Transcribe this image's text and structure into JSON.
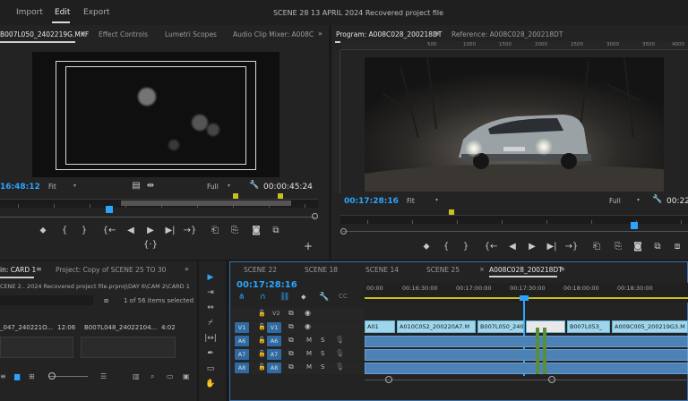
{
  "menu": {
    "import": "Import",
    "edit": "Edit",
    "export": "Export"
  },
  "window_title": "SCENE 28 13 APRIL 2024 Recovered project file",
  "source_panel": {
    "tabs": [
      "B007L050_2402219G.MXF",
      "Effect Controls",
      "Lumetri Scopes",
      "Audio Clip Mixer: A008C"
    ],
    "timecode": "16:48:12",
    "fit": "Fit",
    "quality": "Full",
    "duration": "00:00:45:24"
  },
  "program_panel": {
    "tabs": [
      "Program: A008C028_200218DT",
      "Reference: A008C028_200218DT"
    ],
    "timecode": "00:17:28:16",
    "fit": "Fit",
    "quality": "Full",
    "duration": "00:22",
    "ruler_labels": [
      "500",
      "1000",
      "1500",
      "2000",
      "2500",
      "3000",
      "3500",
      "4000"
    ]
  },
  "project_panel": {
    "tabs": [
      "in: CARD 1",
      "Project: Copy of SCENE 25 TO 30"
    ],
    "path": "CENE 2.. 2024 Recovered project file.prproj\\DAY 6\\CAM 2\\CARD 1",
    "selection": "1 of 56 items selected",
    "items": [
      {
        "name": "_047_240221O...",
        "duration": "12:06"
      },
      {
        "name": "B007L048_24022104...",
        "duration": "4:02"
      }
    ]
  },
  "timeline": {
    "tabs": [
      "SCENE 22",
      "SCENE 18",
      "SCENE 14",
      "SCENE 25",
      "A008C028_200218DT"
    ],
    "timecode": "00:17:28:16",
    "ruler_labels": [
      "00:00",
      "00:16:30:00",
      "00:17:00:00",
      "00:17:30:00",
      "00:18:00:00",
      "00:18:30:00"
    ],
    "video_tracks": [
      {
        "label": "V2",
        "src": ""
      },
      {
        "label": "V1",
        "src": "V1"
      }
    ],
    "audio_tracks": [
      {
        "label": "A6",
        "src": "A6",
        "m": "M",
        "s": "S"
      },
      {
        "label": "A7",
        "src": "A7",
        "m": "M",
        "s": "S"
      },
      {
        "label": "A8",
        "src": "A8",
        "m": "M",
        "s": "S"
      }
    ],
    "clips": [
      {
        "name": "A01"
      },
      {
        "name": "A010C052_200220A7.M"
      },
      {
        "name": "B007L050_240"
      },
      {
        "name": "B007L053_"
      },
      {
        "name": "A009C005_200219G3.M"
      }
    ]
  },
  "colors": {
    "accent": "#2aa5ff",
    "video_clip": "#9fd6ee",
    "audio_clip": "#4c82b5",
    "playhead": "#2aa5ff"
  }
}
